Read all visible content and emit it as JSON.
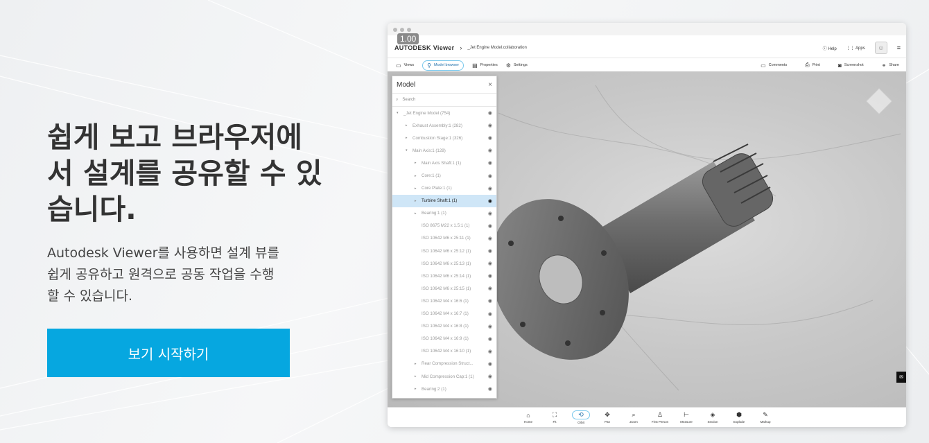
{
  "hero": {
    "title": "쉽게 보고 브라우저에서 설계를 공유할 수 있습니다.",
    "subtitle": "Autodesk Viewer를 사용하면 설계 뷰를 쉽게 공유하고 원격으로 공동 작업을 수행할 수 있습니다.",
    "cta_label": "보기 시작하기"
  },
  "viewer": {
    "version_badge": "1.00",
    "logo_text": "AUTODESK",
    "logo_product": "Viewer",
    "breadcrumb": "_Jet Engine Model.collaboration",
    "help_label": "Help",
    "apps_label": "Apps",
    "toolbar": {
      "views": "Views",
      "model_browser": "Model browser",
      "properties": "Properties",
      "settings": "Settings",
      "comments": "Comments",
      "print": "Print",
      "screenshot": "Screenshot",
      "share": "Share"
    },
    "panel": {
      "title": "Model",
      "close": "×",
      "search_placeholder": "Search",
      "items": [
        {
          "label": "_Jet Engine Model (754)",
          "indent": 0,
          "expanded": true
        },
        {
          "label": "Exhaust Assembly:1 (282)",
          "indent": 1,
          "expanded": false
        },
        {
          "label": "Combustion Stage:1 (326)",
          "indent": 1,
          "expanded": false
        },
        {
          "label": "Main Axis:1 (128)",
          "indent": 1,
          "expanded": true
        },
        {
          "label": "Main Axis Shaft:1 (1)",
          "indent": 2,
          "expanded": false
        },
        {
          "label": "Core:1 (1)",
          "indent": 2,
          "expanded": false
        },
        {
          "label": "Core Plate:1 (1)",
          "indent": 2,
          "expanded": false
        },
        {
          "label": "Turbine Shaft:1 (1)",
          "indent": 2,
          "expanded": false,
          "selected": true
        },
        {
          "label": "Bearing:1 (1)",
          "indent": 2,
          "expanded": false
        },
        {
          "label": "ISO 8675 M22 x 1.5:1 (1)",
          "indent": 2
        },
        {
          "label": "ISO 10642 M6 x 25:11 (1)",
          "indent": 2
        },
        {
          "label": "ISO 10642 M6 x 25:12 (1)",
          "indent": 2
        },
        {
          "label": "ISO 10642 M6 x 25:13 (1)",
          "indent": 2
        },
        {
          "label": "ISO 10642 M6 x 25:14 (1)",
          "indent": 2
        },
        {
          "label": "ISO 10642 M6 x 25:15 (1)",
          "indent": 2
        },
        {
          "label": "ISO 10642 M4 x 16:6 (1)",
          "indent": 2
        },
        {
          "label": "ISO 10642 M4 x 16:7 (1)",
          "indent": 2
        },
        {
          "label": "ISO 10642 M4 x 16:8 (1)",
          "indent": 2
        },
        {
          "label": "ISO 10642 M4 x 16:9 (1)",
          "indent": 2
        },
        {
          "label": "ISO 10642 M4 x 16:10 (1)",
          "indent": 2
        },
        {
          "label": "Rear Compression Struct...",
          "indent": 2,
          "expanded": false
        },
        {
          "label": "Mid Compression Cap:1 (1)",
          "indent": 2,
          "expanded": false
        },
        {
          "label": "Bearing:2 (1)",
          "indent": 2,
          "expanded": false
        }
      ]
    },
    "dock": [
      {
        "label": "Home",
        "icon": "home-icon",
        "glyph": "⌂"
      },
      {
        "label": "Fit",
        "icon": "fit-icon",
        "glyph": "⛶"
      },
      {
        "label": "Orbit",
        "icon": "orbit-icon",
        "glyph": "⟲",
        "active": true
      },
      {
        "label": "Pan",
        "icon": "pan-icon",
        "glyph": "✥"
      },
      {
        "label": "Zoom",
        "icon": "zoom-icon",
        "glyph": "⌕"
      },
      {
        "label": "First Person",
        "icon": "first-person-icon",
        "glyph": "♙"
      },
      {
        "label": "Measure",
        "icon": "measure-icon",
        "glyph": "⊢"
      },
      {
        "label": "Section",
        "icon": "section-icon",
        "glyph": "◈"
      },
      {
        "label": "Explode",
        "icon": "explode-icon",
        "glyph": "⬢"
      },
      {
        "label": "Markup",
        "icon": "markup-icon",
        "glyph": "✎"
      }
    ]
  },
  "colors": {
    "accent": "#06a7e0",
    "selected_row": "#cfe6f7"
  }
}
